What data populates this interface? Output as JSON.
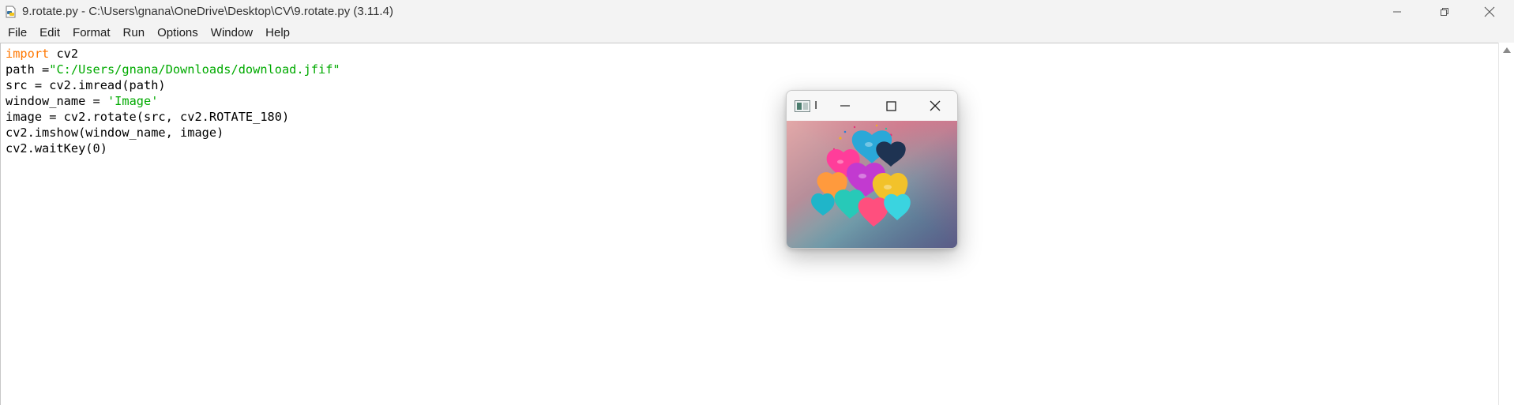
{
  "window": {
    "title": "9.rotate.py - C:\\Users\\gnana\\OneDrive\\Desktop\\CV\\9.rotate.py (3.11.4)"
  },
  "menu": {
    "items": [
      "File",
      "Edit",
      "Format",
      "Run",
      "Options",
      "Window",
      "Help"
    ]
  },
  "editor": {
    "lines": [
      {
        "kw": "import",
        "rest": " cv2"
      },
      {
        "pre": "path =",
        "str": "\"C:/Users/gnana/Downloads/download.jfif\""
      },
      {
        "text": "src = cv2.imread(path)"
      },
      {
        "pre": "window_name = ",
        "str": "'Image'"
      },
      {
        "text": "image = cv2.rotate(src, cv2.ROTATE_180)"
      },
      {
        "text": "cv2.imshow(window_name, image)"
      },
      {
        "text": "cv2.waitKey(0)"
      }
    ]
  },
  "image_window": {
    "title": "I"
  },
  "colors": {
    "keyword": "#ff7700",
    "string": "#00aa00",
    "titlebar": "#f3f3f3"
  }
}
